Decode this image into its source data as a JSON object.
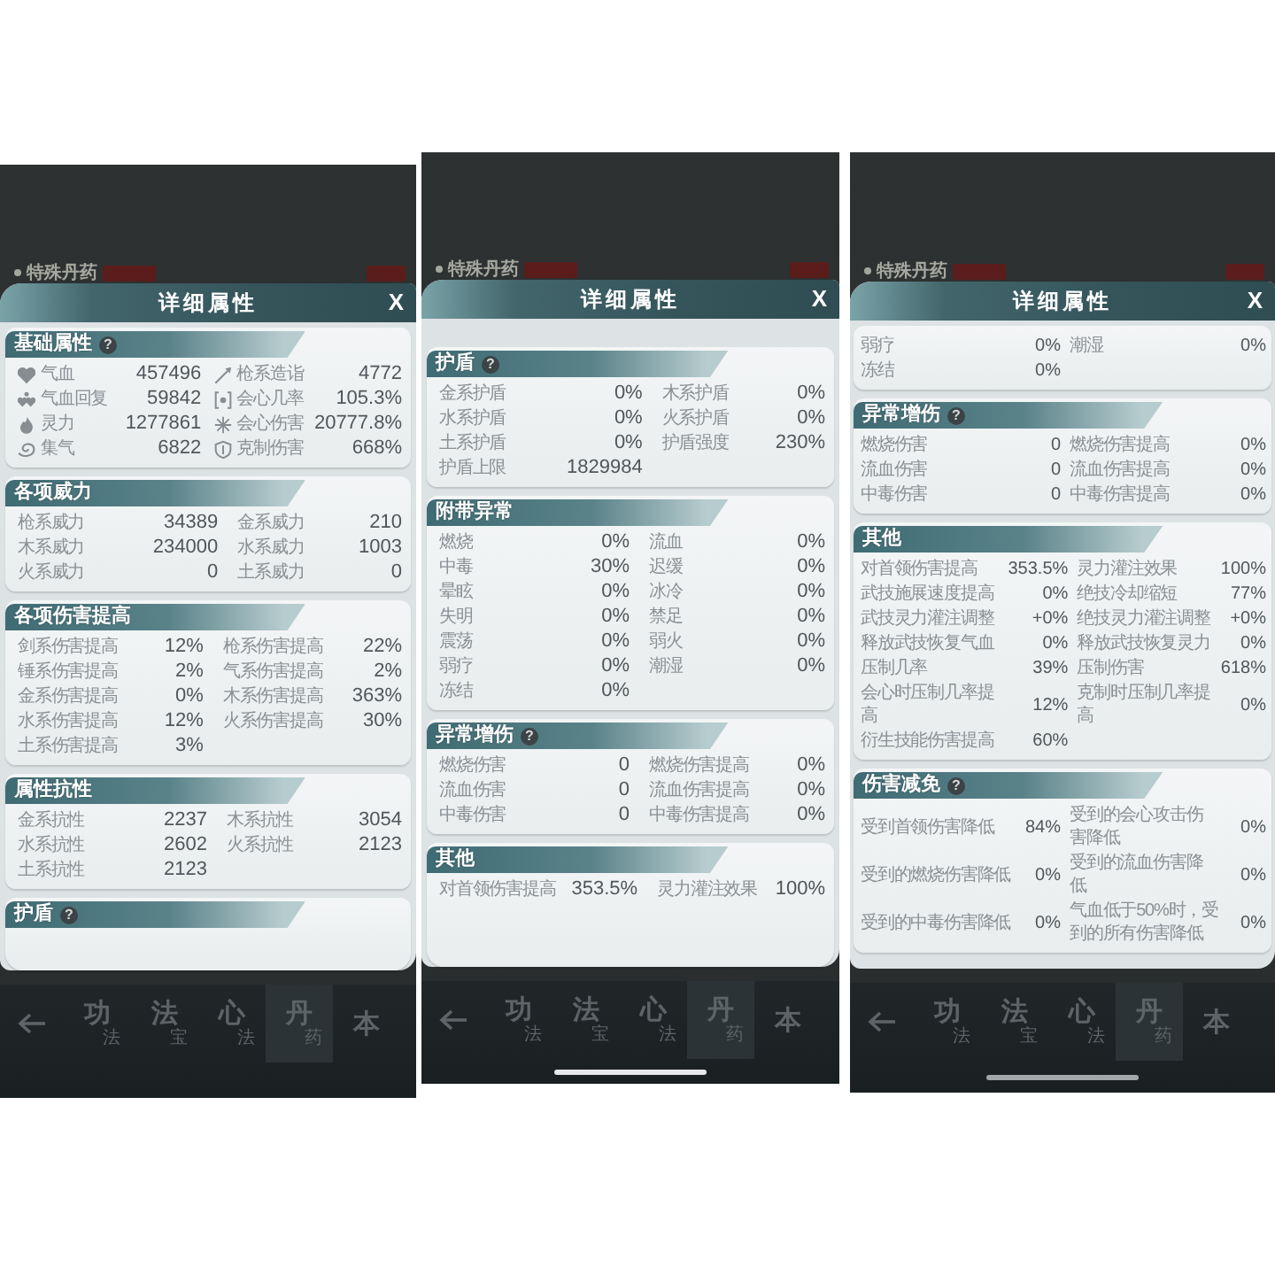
{
  "screens": [
    {
      "background": {
        "title": "特殊丹药"
      },
      "dialog": {
        "title": "详细属性",
        "close": "X",
        "sections": [
          {
            "title": "基础属性",
            "help": "?",
            "kind": "icon_rows",
            "stats": [
              {
                "label": "气血",
                "value": "457496"
              },
              {
                "label": "枪系造诣",
                "value": "4772"
              },
              {
                "label": "气血回复",
                "value": "59842"
              },
              {
                "label": "会心几率",
                "value": "105.3%"
              },
              {
                "label": "灵力",
                "value": "1277861"
              },
              {
                "label": "会心伤害",
                "value": "20777.8%"
              },
              {
                "label": "集气",
                "value": "6822"
              },
              {
                "label": "克制伤害",
                "value": "668%"
              }
            ]
          },
          {
            "title": "各项威力",
            "kind": "rows",
            "stats": [
              {
                "label": "枪系威力",
                "value": "34389"
              },
              {
                "label": "金系威力",
                "value": "210"
              },
              {
                "label": "木系威力",
                "value": "234000"
              },
              {
                "label": "水系威力",
                "value": "1003"
              },
              {
                "label": "火系威力",
                "value": "0"
              },
              {
                "label": "土系威力",
                "value": "0"
              }
            ]
          },
          {
            "title": "各项伤害提高",
            "kind": "rows",
            "stats": [
              {
                "label": "剑系伤害提高",
                "value": "12%"
              },
              {
                "label": "枪系伤害提高",
                "value": "22%"
              },
              {
                "label": "锤系伤害提高",
                "value": "2%"
              },
              {
                "label": "气系伤害提高",
                "value": "2%"
              },
              {
                "label": "金系伤害提高",
                "value": "0%"
              },
              {
                "label": "木系伤害提高",
                "value": "363%"
              },
              {
                "label": "水系伤害提高",
                "value": "12%"
              },
              {
                "label": "火系伤害提高",
                "value": "30%"
              },
              {
                "label": "土系伤害提高",
                "value": "3%"
              }
            ]
          },
          {
            "title": "属性抗性",
            "kind": "rows",
            "stats": [
              {
                "label": "金系抗性",
                "value": "2237"
              },
              {
                "label": "木系抗性",
                "value": "3054"
              },
              {
                "label": "水系抗性",
                "value": "2602"
              },
              {
                "label": "火系抗性",
                "value": "2123"
              },
              {
                "label": "土系抗性",
                "value": "2123"
              }
            ]
          },
          {
            "title": "护盾",
            "help": "?",
            "kind": "rows"
          }
        ]
      },
      "nav": {
        "tabs": [
          {
            "main": "功",
            "sub": "法",
            "selected": false
          },
          {
            "main": "法",
            "sub": "宝",
            "selected": false
          },
          {
            "main": "心",
            "sub": "法",
            "selected": false
          },
          {
            "main": "丹",
            "sub": "药",
            "selected": true
          },
          {
            "main": "本",
            "selected": false
          }
        ]
      },
      "home_indicator": false
    },
    {
      "background": {
        "title": "特殊丹药"
      },
      "dialog": {
        "title": "详细属性",
        "close": "X",
        "sections": [
          {
            "title": "护盾",
            "help": "?",
            "kind": "rows",
            "stats": [
              {
                "label": "金系护盾",
                "value": "0%"
              },
              {
                "label": "木系护盾",
                "value": "0%"
              },
              {
                "label": "水系护盾",
                "value": "0%"
              },
              {
                "label": "火系护盾",
                "value": "0%"
              },
              {
                "label": "土系护盾",
                "value": "0%"
              },
              {
                "label": "护盾强度",
                "value": "230%"
              },
              {
                "label": "护盾上限",
                "value": "1829984"
              }
            ]
          },
          {
            "title": "附带异常",
            "kind": "rows",
            "stats": [
              {
                "label": "燃烧",
                "value": "0%"
              },
              {
                "label": "流血",
                "value": "0%"
              },
              {
                "label": "中毒",
                "value": "30%"
              },
              {
                "label": "迟缓",
                "value": "0%"
              },
              {
                "label": "晕眩",
                "value": "0%"
              },
              {
                "label": "冰冷",
                "value": "0%"
              },
              {
                "label": "失明",
                "value": "0%"
              },
              {
                "label": "禁足",
                "value": "0%"
              },
              {
                "label": "震荡",
                "value": "0%"
              },
              {
                "label": "弱火",
                "value": "0%"
              },
              {
                "label": "弱疗",
                "value": "0%"
              },
              {
                "label": "潮湿",
                "value": "0%"
              },
              {
                "label": "冻结",
                "value": "0%"
              }
            ]
          },
          {
            "title": "异常增伤",
            "help": "?",
            "kind": "rows",
            "stats": [
              {
                "label": "燃烧伤害",
                "value": "0"
              },
              {
                "label": "燃烧伤害提高",
                "value": "0%"
              },
              {
                "label": "流血伤害",
                "value": "0"
              },
              {
                "label": "流血伤害提高",
                "value": "0%"
              },
              {
                "label": "中毒伤害",
                "value": "0"
              },
              {
                "label": "中毒伤害提高",
                "value": "0%"
              }
            ]
          },
          {
            "title": "其他",
            "kind": "rows",
            "stats": [
              {
                "label": "对首领伤害提高",
                "value": "353.5%"
              },
              {
                "label": "灵力灌注效果",
                "value": "100%"
              }
            ]
          }
        ]
      },
      "nav": {
        "tabs": [
          {
            "main": "功",
            "sub": "法",
            "selected": false
          },
          {
            "main": "法",
            "sub": "宝",
            "selected": false
          },
          {
            "main": "心",
            "sub": "法",
            "selected": false
          },
          {
            "main": "丹",
            "sub": "药",
            "selected": true
          },
          {
            "main": "本",
            "selected": false
          }
        ]
      },
      "home_indicator": true
    },
    {
      "background": {
        "title": "特殊丹药"
      },
      "dialog": {
        "title": "详细属性",
        "close": "X",
        "sections": [
          {
            "kind": "rows",
            "stats": [
              {
                "label": "弱疗",
                "value": "0%"
              },
              {
                "label": "潮湿",
                "value": "0%"
              },
              {
                "label": "冻结",
                "value": "0%"
              }
            ]
          },
          {
            "title": "异常增伤",
            "help": "?",
            "kind": "rows",
            "stats": [
              {
                "label": "燃烧伤害",
                "value": "0"
              },
              {
                "label": "燃烧伤害提高",
                "value": "0%"
              },
              {
                "label": "流血伤害",
                "value": "0"
              },
              {
                "label": "流血伤害提高",
                "value": "0%"
              },
              {
                "label": "中毒伤害",
                "value": "0"
              },
              {
                "label": "中毒伤害提高",
                "value": "0%"
              }
            ]
          },
          {
            "title": "其他",
            "kind": "rows",
            "stats": [
              {
                "label": "对首领伤害提高",
                "value": "353.5%"
              },
              {
                "label": "灵力灌注效果",
                "value": "100%"
              },
              {
                "label": "武技施展速度提高",
                "value": "0%"
              },
              {
                "label": "绝技冷却缩短",
                "value": "77%"
              },
              {
                "label": "武技灵力灌注调整",
                "value": "+0%"
              },
              {
                "label": "绝技灵力灌注调整",
                "value": "+0%"
              },
              {
                "label": "释放武技恢复气血",
                "value": "0%"
              },
              {
                "label": "释放武技恢复灵力",
                "value": "0%"
              },
              {
                "label": "压制几率",
                "value": "39%"
              },
              {
                "label": "压制伤害",
                "value": "618%"
              },
              {
                "label": "会心时压制几率提高",
                "value": "12%"
              },
              {
                "label": "克制时压制几率提高",
                "value": "0%"
              },
              {
                "label": "衍生技能伤害提高",
                "value": "60%"
              }
            ]
          },
          {
            "title": "伤害减免",
            "help": "?",
            "kind": "rows",
            "stats": [
              {
                "label": "受到首领伤害降低",
                "value": "84%"
              },
              {
                "label": "受到的会心攻击伤害降低",
                "value": "0%"
              },
              {
                "label": "受到的燃烧伤害降低",
                "value": "0%"
              },
              {
                "label": "受到的流血伤害降低",
                "value": "0%"
              },
              {
                "label": "受到的中毒伤害降低",
                "value": "0%"
              },
              {
                "label": "气血低于50%时，受到的所有伤害降低",
                "value": "0%"
              }
            ]
          }
        ]
      },
      "nav": {
        "tabs": [
          {
            "main": "功",
            "sub": "法",
            "selected": false
          },
          {
            "main": "法",
            "sub": "宝",
            "selected": false
          },
          {
            "main": "心",
            "sub": "法",
            "selected": false
          },
          {
            "main": "丹",
            "sub": "药",
            "selected": true
          },
          {
            "main": "本",
            "selected": false
          }
        ]
      },
      "home_indicator": true
    }
  ]
}
